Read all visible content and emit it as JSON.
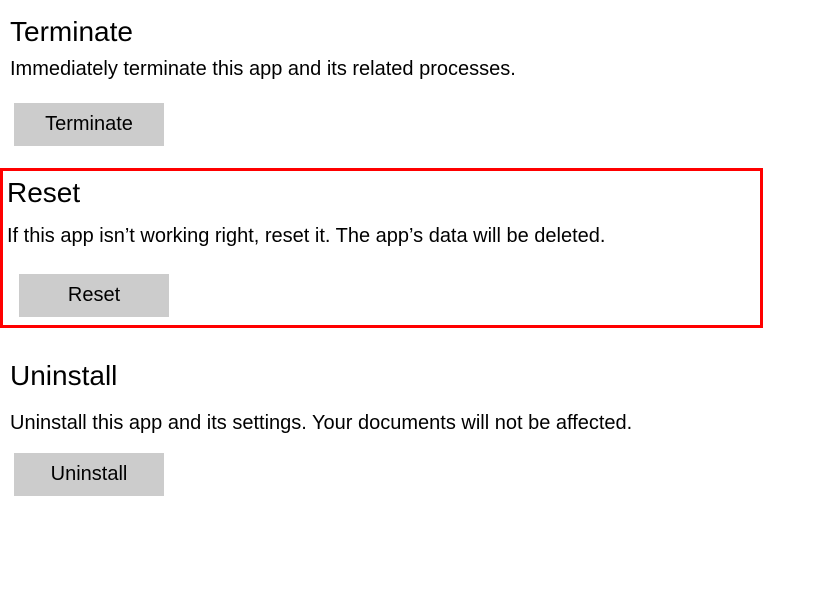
{
  "terminate": {
    "heading": "Terminate",
    "description": "Immediately terminate this app and its related processes.",
    "button_label": "Terminate"
  },
  "reset": {
    "heading": "Reset",
    "description": "If this app isn’t working right, reset it. The app’s data will be deleted.",
    "button_label": "Reset"
  },
  "uninstall": {
    "heading": "Uninstall",
    "description": "Uninstall this app and its settings. Your documents will not be affected.",
    "button_label": "Uninstall"
  }
}
